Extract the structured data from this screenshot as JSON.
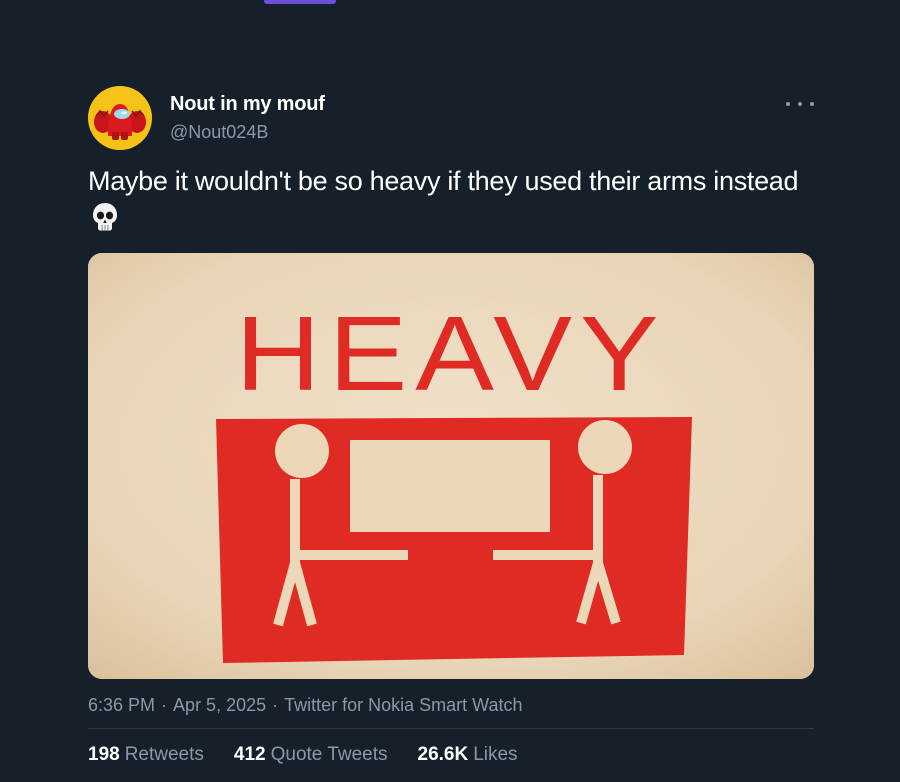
{
  "tweet": {
    "author": {
      "display_name": "Nout in my mouf",
      "handle": "@Nout024B",
      "avatar_icon": "red-crewmate-avatar"
    },
    "more_icon": "more-dots-icon",
    "text": "Maybe it wouldn't be so heavy if they used their arms instead",
    "emoji_icon": "skull-emoji-icon",
    "media": {
      "sign_text": "HEAVY",
      "sign_color": "#e02a24"
    },
    "time": "6:36 PM",
    "date": "Apr 5, 2025",
    "source": "Twitter for Nokia Smart Watch",
    "separator": "·",
    "stats": {
      "retweets_count": "198",
      "retweets_label": "Retweets",
      "quotes_count": "412",
      "quotes_label": "Quote Tweets",
      "likes_count": "26.6K",
      "likes_label": "Likes"
    }
  },
  "colors": {
    "background": "#15202b",
    "secondary_text": "#8b98a5",
    "avatar_bg": "#f3c417"
  }
}
